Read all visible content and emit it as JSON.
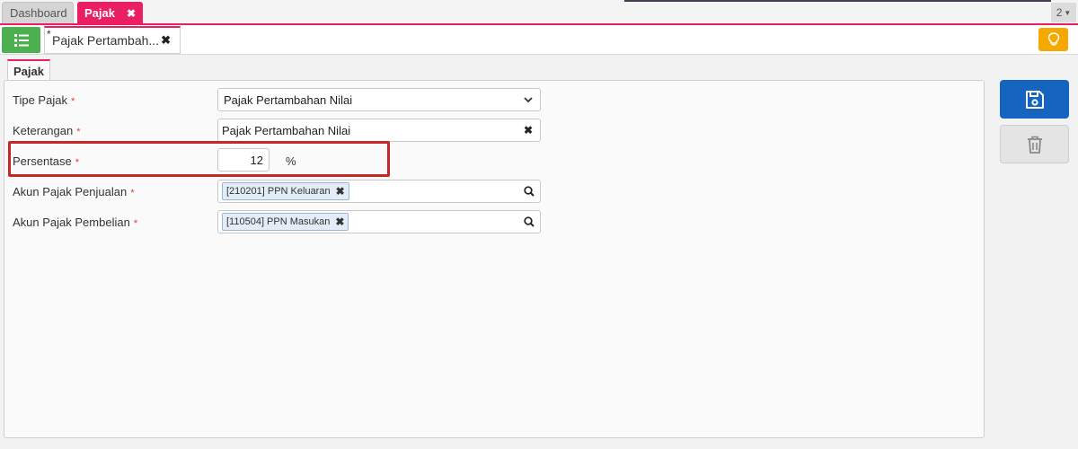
{
  "top_tabs": {
    "dashboard_label": "Dashboard",
    "active_label": "Pajak",
    "window_count": "2"
  },
  "doc_tab": {
    "modified_marker": "*",
    "label": "Pajak Pertambah..."
  },
  "section_tab": {
    "label": "Pajak"
  },
  "form": {
    "tipe_pajak": {
      "label": "Tipe Pajak",
      "required": "*",
      "value": "Pajak Pertambahan Nilai"
    },
    "keterangan": {
      "label": "Keterangan",
      "required": "*",
      "value": "Pajak Pertambahan Nilai"
    },
    "persentase": {
      "label": "Persentase",
      "required": "*",
      "value": "12",
      "unit": "%"
    },
    "akun_penjualan": {
      "label": "Akun Pajak Penjualan",
      "required": "*",
      "chip": "[210201] PPN Keluaran"
    },
    "akun_pembelian": {
      "label": "Akun Pajak Pembelian",
      "required": "*",
      "chip": "[110504] PPN Masukan"
    }
  },
  "colors": {
    "accent": "#e91e63",
    "menu_green": "#4caf50",
    "hint_orange": "#f5a800",
    "save_blue": "#1565c0",
    "highlight_red": "#c62828"
  },
  "icons": {
    "menu": "list-icon",
    "hint": "lightbulb-icon",
    "save": "floppy-disk-icon",
    "delete": "trash-icon",
    "search": "search-icon"
  }
}
